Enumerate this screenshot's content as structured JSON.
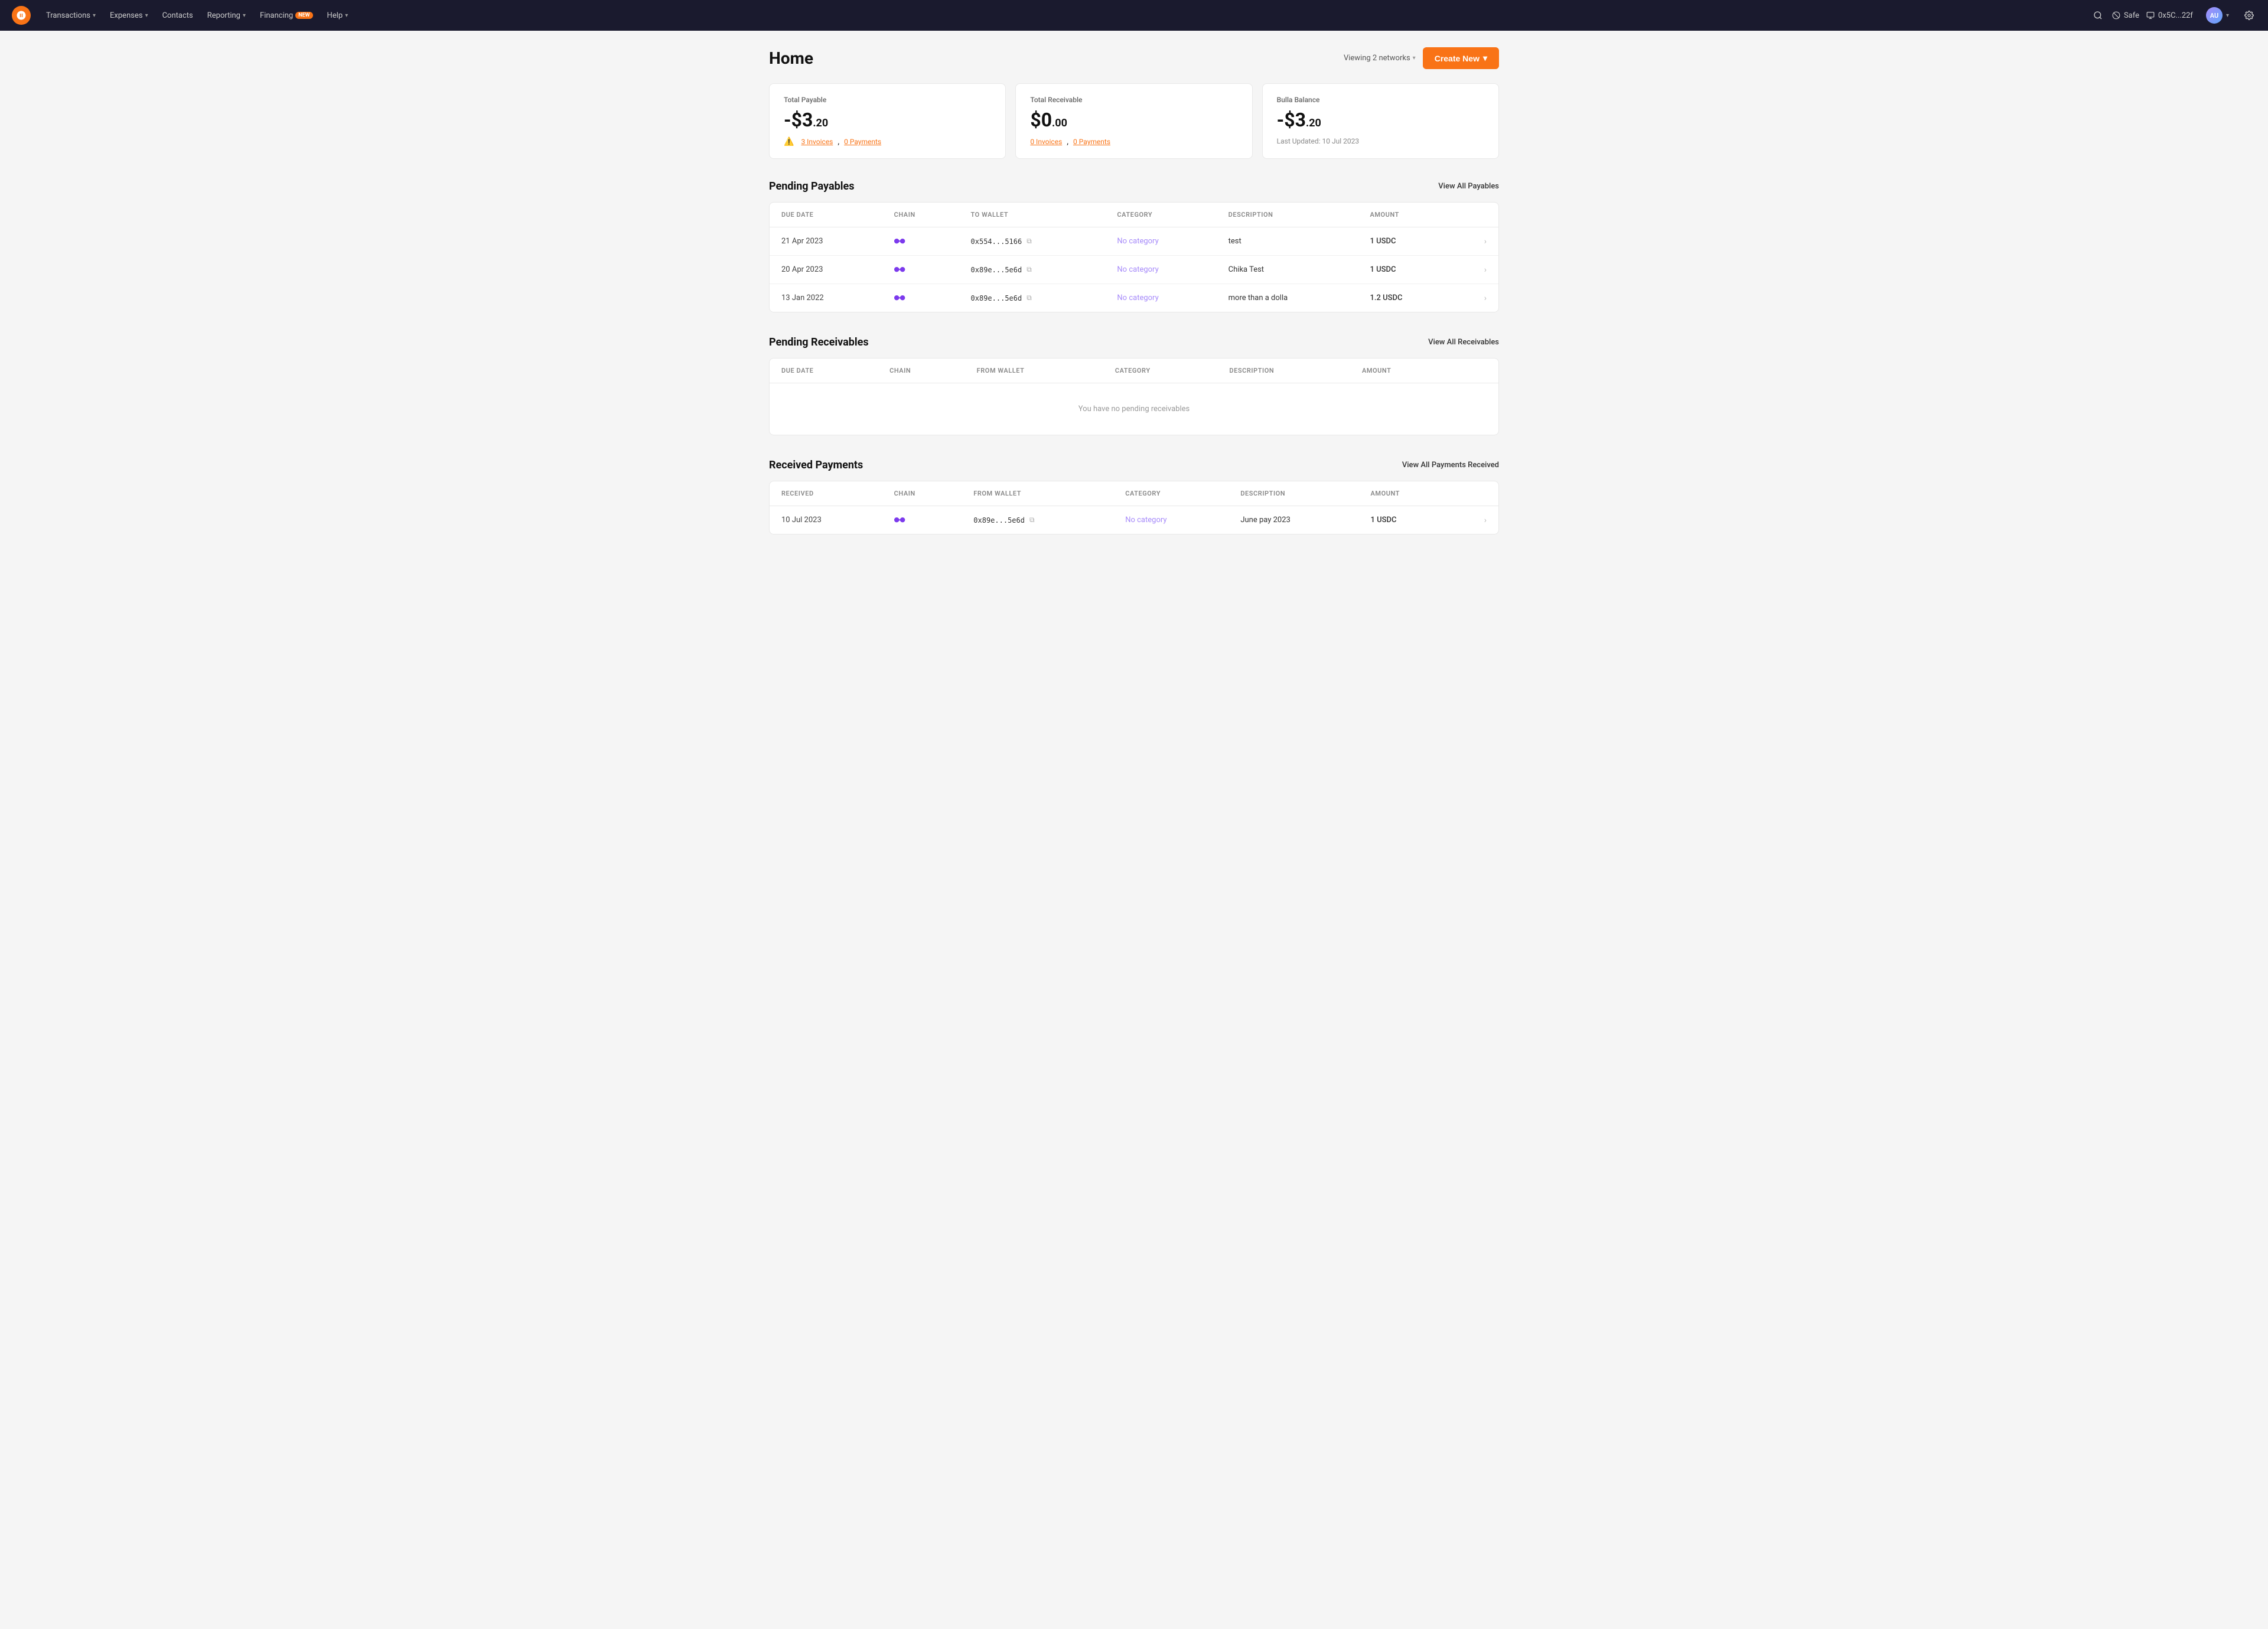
{
  "nav": {
    "logo_alt": "Bulla Logo",
    "items": [
      {
        "label": "Transactions",
        "has_dropdown": true
      },
      {
        "label": "Expenses",
        "has_dropdown": true
      },
      {
        "label": "Contacts",
        "has_dropdown": false
      },
      {
        "label": "Reporting",
        "has_dropdown": true
      },
      {
        "label": "Financing",
        "has_dropdown": false,
        "badge": "NEW"
      },
      {
        "label": "Help",
        "has_dropdown": true
      }
    ],
    "safe_label": "Safe",
    "wallet_label": "0x5C...22f",
    "avatar_text": "AU"
  },
  "page": {
    "title": "Home",
    "viewing_networks_label": "Viewing 2 networks",
    "create_new_label": "Create New"
  },
  "stat_cards": [
    {
      "label": "Total Payable",
      "value_prefix": "-$",
      "value_main": "3",
      "value_cents": ".20",
      "warning": true,
      "links": [
        {
          "text": "3 Invoices",
          "key": "payable_invoices"
        },
        {
          "text": "0 Payments",
          "key": "payable_payments"
        }
      ]
    },
    {
      "label": "Total Receivable",
      "value_prefix": "$",
      "value_main": "0",
      "value_cents": ".00",
      "warning": false,
      "links": [
        {
          "text": "0 Invoices",
          "key": "receivable_invoices"
        },
        {
          "text": "0 Payments",
          "key": "receivable_payments"
        }
      ]
    },
    {
      "label": "Bulla Balance",
      "value_prefix": "-$",
      "value_main": "3",
      "value_cents": ".20",
      "warning": false,
      "last_updated": "Last Updated: 10 Jul 2023"
    }
  ],
  "pending_payables": {
    "title": "Pending Payables",
    "view_all_label": "View All Payables",
    "columns": [
      "DUE DATE",
      "CHAIN",
      "TO WALLET",
      "CATEGORY",
      "DESCRIPTION",
      "AMOUNT"
    ],
    "rows": [
      {
        "due_date": "21 Apr 2023",
        "chain": "polygon",
        "to_wallet": "0x554...5166",
        "category": "No category",
        "description": "test",
        "amount": "1 USDC"
      },
      {
        "due_date": "20 Apr 2023",
        "chain": "polygon",
        "to_wallet": "0x89e...5e6d",
        "category": "No category",
        "description": "Chika Test",
        "amount": "1 USDC"
      },
      {
        "due_date": "13 Jan 2022",
        "chain": "polygon",
        "to_wallet": "0x89e...5e6d",
        "category": "No category",
        "description": "more than a dolla",
        "amount": "1.2  USDC"
      }
    ]
  },
  "pending_receivables": {
    "title": "Pending Receivables",
    "view_all_label": "View All Receivables",
    "columns": [
      "DUE DATE",
      "CHAIN",
      "FROM WALLET",
      "CATEGORY",
      "DESCRIPTION",
      "AMOUNT"
    ],
    "empty_message": "You have no pending receivables",
    "rows": []
  },
  "received_payments": {
    "title": "Received Payments",
    "view_all_label": "View All Payments Received",
    "columns": [
      "RECEIVED",
      "CHAIN",
      "FROM WALLET",
      "CATEGORY",
      "DESCRIPTION",
      "AMOUNT"
    ],
    "rows": [
      {
        "received_date": "10 Jul 2023",
        "chain": "polygon",
        "from_wallet": "0x89e...5e6d",
        "category": "No category",
        "description": "June pay 2023",
        "amount": "1 USDC"
      }
    ]
  }
}
